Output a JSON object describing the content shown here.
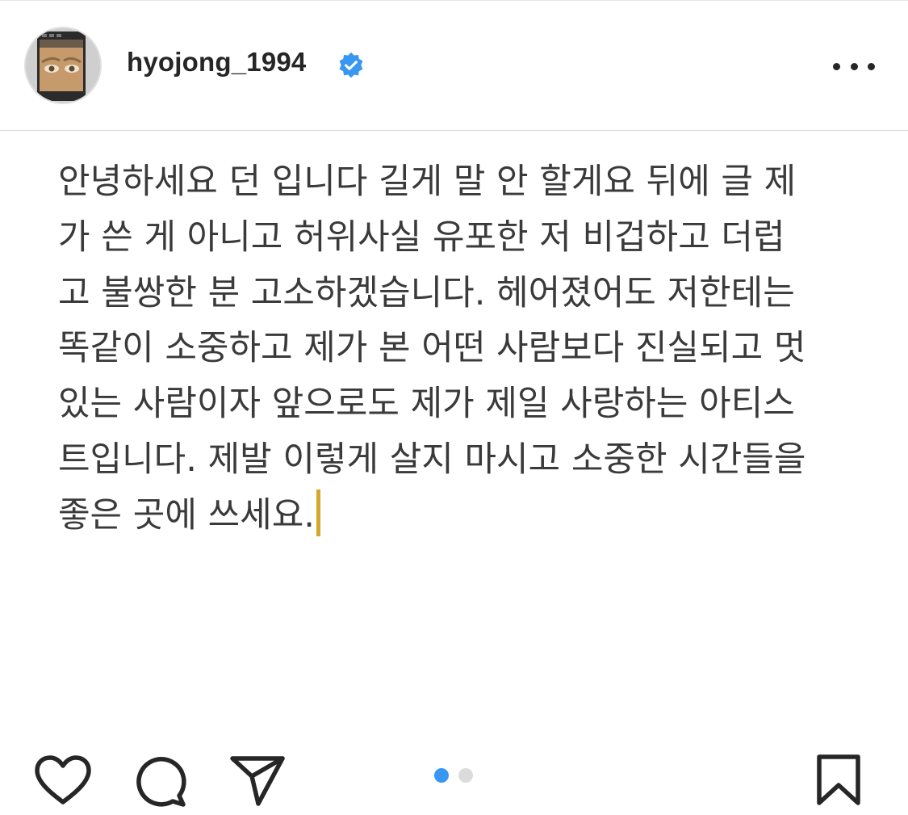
{
  "header": {
    "username": "hyojong_1994",
    "verified": true,
    "verified_color": "#3897f0",
    "avatar_icon": "profile-photo",
    "more_icon": "more-horizontal-icon"
  },
  "post": {
    "caption_lines": [
      "안녕하세요 던 입니다 길게 말 안 할게요 뒤에 글 제",
      "가 쓴 게 아니고 허위사실 유포한 저 비겁하고 더럽",
      "고 불쌍한 분 고소하겠습니다. 헤어졌어도 저한테는",
      "똑같이 소중하고 제가 본 어떤 사람보다 진실되고 멋",
      "있는 사람이자 앞으로도 제가 제일 사랑하는 아티스",
      "트입니다. 제발 이렇게 살지 마시고 소중한 시간들을",
      "좋은 곳에 쓰세요."
    ],
    "cursor_color": "#d4a72c"
  },
  "carousel": {
    "count": 2,
    "active_index": 0,
    "active_color": "#3897f0",
    "inactive_color": "#dbdbdb"
  },
  "actions": {
    "like_icon": "heart-icon",
    "comment_icon": "comment-icon",
    "share_icon": "send-icon",
    "save_icon": "bookmark-icon"
  }
}
